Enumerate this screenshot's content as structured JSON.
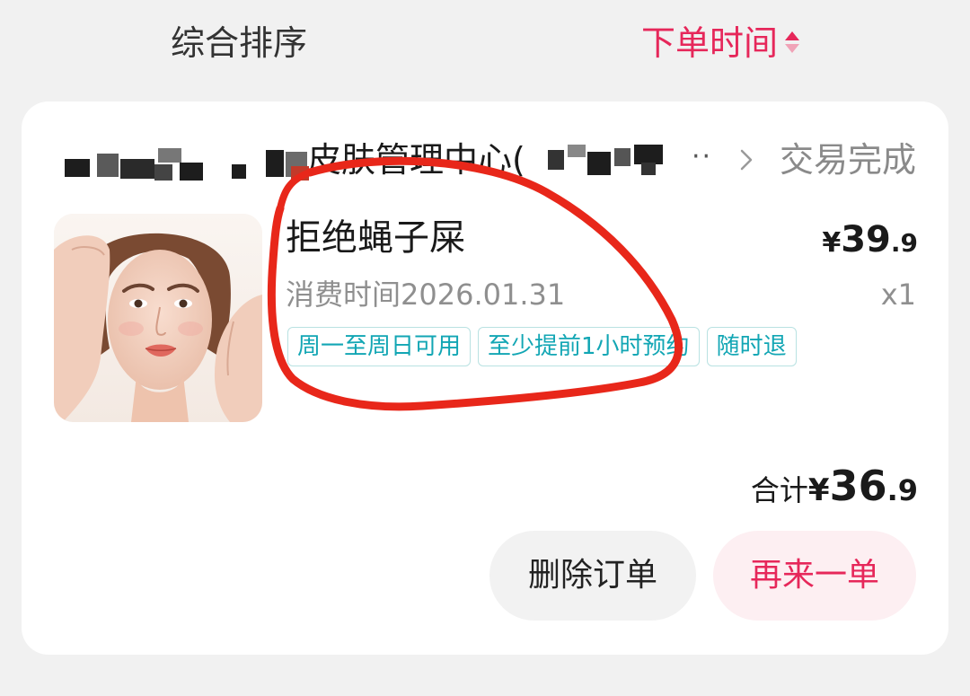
{
  "sort_bar": {
    "comprehensive_label": "综合排序",
    "order_time_label": "下单时间",
    "active_color": "#e6275a"
  },
  "order": {
    "shop_name_visible": "皮肤管理中心(",
    "ellipsis": "··",
    "status": "交易完成",
    "product": {
      "title": "拒绝蝇子屎",
      "price_yen": "¥",
      "price_int": "39",
      "price_dec": ".9",
      "consume_time": "消费时间2026.01.31",
      "quantity": "x1",
      "tags": [
        "周一至周日可用",
        "至少提前1小时预约",
        "随时退"
      ]
    },
    "total": {
      "label": "合计",
      "yen": "¥",
      "int": "36",
      "dec": ".9"
    },
    "buttons": {
      "delete_label": "删除订单",
      "reorder_label": "再来一单"
    }
  },
  "icons": {
    "sort": "sort-arrows-icon",
    "chevron": "chevron-right-icon"
  },
  "colors": {
    "tag_text": "#12a6b4",
    "tag_border": "#b9e2e2",
    "annotation": "#e8271a"
  }
}
